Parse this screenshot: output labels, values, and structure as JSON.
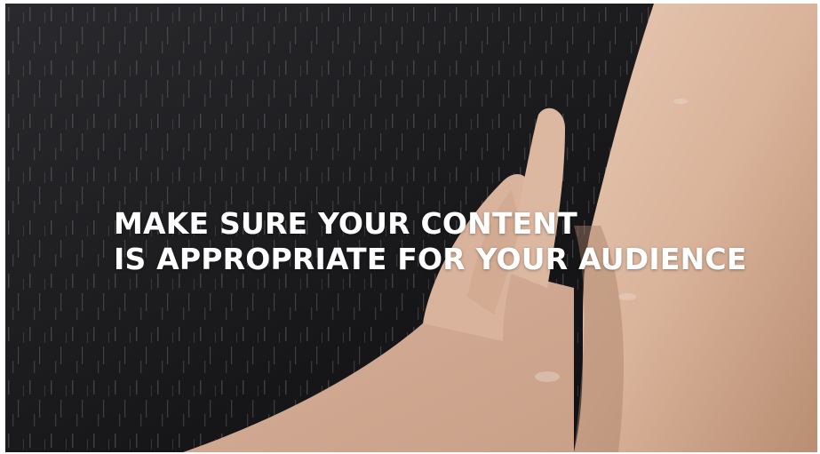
{
  "overlay_text": {
    "line1": "MAKE SURE YOUR CONTENT",
    "line2": "IS APPROPRIATE FOR YOUR AUDIENCE"
  },
  "colors": {
    "background": "#1a1a1d",
    "skin": "#d9b49a",
    "text": "#ffffff"
  }
}
